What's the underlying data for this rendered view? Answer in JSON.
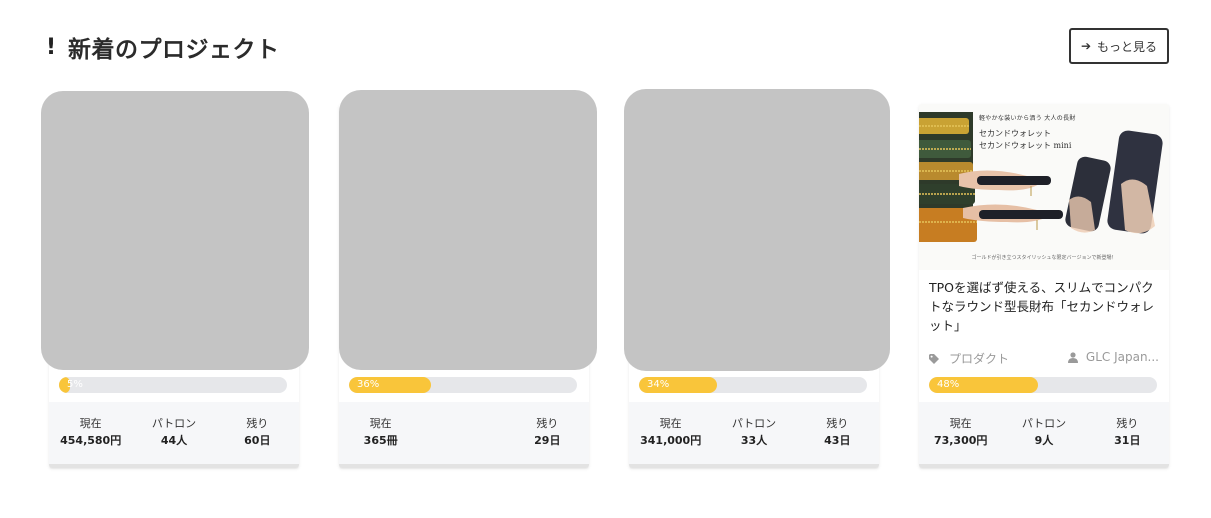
{
  "header": {
    "icon": "exclamation-icon",
    "title": "新着のプロジェクト",
    "more_label": "もっと見る"
  },
  "colors": {
    "progress_fill": "#f9c53a",
    "progress_track": "#e6e7ea",
    "placeholder": "#c4c4c4",
    "stats_bg": "#f6f7f9"
  },
  "cards": [
    {
      "progress_label": "5%",
      "progress": 0.05,
      "stats": [
        {
          "label": "現在",
          "value": "454,580円"
        },
        {
          "label": "パトロン",
          "value": "44人"
        },
        {
          "label": "残り",
          "value": "60日"
        }
      ]
    },
    {
      "progress_label": "36%",
      "progress": 0.36,
      "stats": [
        {
          "label": "現在",
          "value": "365冊"
        },
        {
          "label": "残り",
          "value": "29日"
        }
      ]
    },
    {
      "progress_label": "34%",
      "progress": 0.34,
      "stats": [
        {
          "label": "現在",
          "value": "341,000円"
        },
        {
          "label": "パトロン",
          "value": "33人"
        },
        {
          "label": "残り",
          "value": "43日"
        }
      ]
    },
    {
      "image_text": {
        "line1": "軽やかな装いから洒う 大人の長財",
        "line2": "セカンドウォレット",
        "line3": "セカンドウォレット mini",
        "caption": "ゴールドが引き立つスタイリッシュな限定バージョンで新登場！"
      },
      "title": "TPOを選ばず使える、スリムでコンパクトなラウンド型長財布「セカンドウォレット」",
      "category": "プロダクト",
      "owner": "GLC Japan...",
      "progress_label": "48%",
      "progress": 0.48,
      "stats": [
        {
          "label": "現在",
          "value": "73,300円"
        },
        {
          "label": "パトロン",
          "value": "9人"
        },
        {
          "label": "残り",
          "value": "31日"
        }
      ]
    }
  ]
}
